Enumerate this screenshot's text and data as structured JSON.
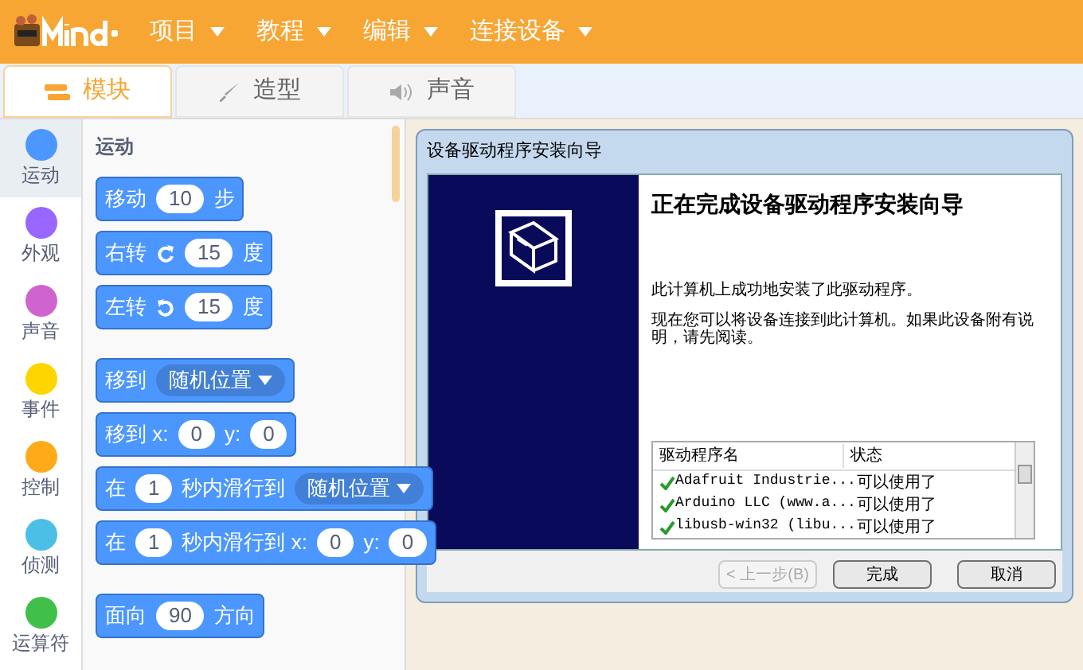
{
  "menu": {
    "items": [
      "项目",
      "教程",
      "编辑",
      "连接设备"
    ]
  },
  "tabs": [
    {
      "label": "模块",
      "selected": true,
      "kind": "blocks"
    },
    {
      "label": "造型",
      "selected": false,
      "kind": "costume"
    },
    {
      "label": "声音",
      "selected": false,
      "kind": "sound"
    }
  ],
  "categories": [
    {
      "label": "运动",
      "color": "#4c97ff",
      "selected": true
    },
    {
      "label": "外观",
      "color": "#9966ff",
      "selected": false
    },
    {
      "label": "声音",
      "color": "#cf63cf",
      "selected": false
    },
    {
      "label": "事件",
      "color": "#ffd500",
      "selected": false
    },
    {
      "label": "控制",
      "color": "#ffab19",
      "selected": false
    },
    {
      "label": "侦测",
      "color": "#4cbfe6",
      "selected": false
    },
    {
      "label": "运算符",
      "color": "#40bf4a",
      "selected": false
    }
  ],
  "palette": {
    "heading": "运动",
    "blocks": [
      [
        {
          "kind": "text",
          "text": "移动"
        },
        {
          "kind": "num",
          "text": "10"
        },
        {
          "kind": "text",
          "text": "步"
        }
      ],
      [
        {
          "kind": "text",
          "text": "右转"
        },
        {
          "kind": "turn_right"
        },
        {
          "kind": "num",
          "text": "15"
        },
        {
          "kind": "text",
          "text": "度"
        }
      ],
      [
        {
          "kind": "text",
          "text": "左转"
        },
        {
          "kind": "turn_left"
        },
        {
          "kind": "num",
          "text": "15"
        },
        {
          "kind": "text",
          "text": "度"
        }
      ],
      [
        {
          "kind": "text",
          "text": "移到"
        },
        {
          "kind": "drop",
          "text": "随机位置"
        }
      ],
      [
        {
          "kind": "text",
          "text": "移到 x:"
        },
        {
          "kind": "num",
          "text": "0"
        },
        {
          "kind": "text",
          "text": "y:"
        },
        {
          "kind": "num",
          "text": "0"
        }
      ],
      [
        {
          "kind": "text",
          "text": "在"
        },
        {
          "kind": "num",
          "text": "1"
        },
        {
          "kind": "text",
          "text": "秒内滑行到"
        },
        {
          "kind": "drop",
          "text": "随机位置"
        }
      ],
      [
        {
          "kind": "text",
          "text": "在"
        },
        {
          "kind": "num",
          "text": "1"
        },
        {
          "kind": "text",
          "text": "秒内滑行到 x:"
        },
        {
          "kind": "num",
          "text": "0"
        },
        {
          "kind": "text",
          "text": "y:"
        },
        {
          "kind": "num",
          "text": "0"
        }
      ],
      [
        {
          "kind": "text",
          "text": "面向"
        },
        {
          "kind": "num",
          "text": "90"
        },
        {
          "kind": "text",
          "text": "方向"
        }
      ]
    ]
  },
  "dialog": {
    "title": "设备驱动程序安装向导",
    "heading": "正在完成设备驱动程序安装向导",
    "paragraphs": [
      "此计算机上成功地安装了此驱动程序。",
      "现在您可以将设备连接到此计算机。如果此设备附有说明，请先阅读。"
    ],
    "table": {
      "columns": [
        "驱动程序名",
        "状态"
      ],
      "rows": [
        {
          "name": "Adafruit Industrie...",
          "status": "可以使用了"
        },
        {
          "name": "Arduino LLC (www.a...",
          "status": "可以使用了"
        },
        {
          "name": "libusb-win32 (libu...",
          "status": "可以使用了"
        }
      ]
    },
    "buttons": [
      {
        "label": "< 上一步(B)",
        "disabled": true
      },
      {
        "label": "完成",
        "disabled": false
      },
      {
        "label": "取消",
        "disabled": false
      }
    ]
  }
}
